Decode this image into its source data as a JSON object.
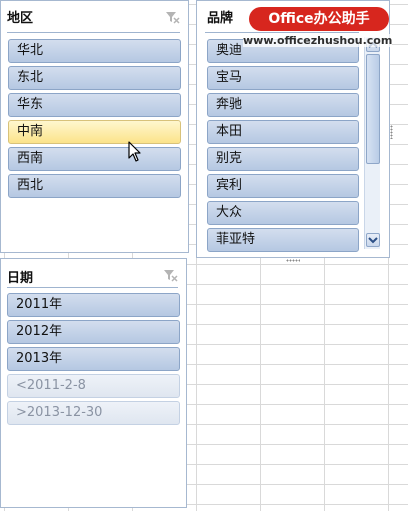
{
  "watermark": {
    "badge_text": "Office办公助手",
    "url": "www.officezhushou.com"
  },
  "slicers": {
    "region": {
      "title": "地区",
      "items": [
        "华北",
        "东北",
        "华东",
        "中南",
        "西南",
        "西北"
      ],
      "hovered_item": "中南"
    },
    "brand": {
      "title": "品牌",
      "items": [
        "奥迪",
        "宝马",
        "奔驰",
        "本田",
        "别克",
        "宾利",
        "大众",
        "菲亚特"
      ]
    },
    "date": {
      "title": "日期",
      "items": [
        "2011年",
        "2012年",
        "2013年"
      ],
      "nodata_items": [
        "<2011-2-8",
        ">2013-12-30"
      ]
    }
  },
  "colors": {
    "item_fill": "#b5c8e2",
    "item_hover": "#fbe38a",
    "brand_red": "#d7261e"
  },
  "icons": {
    "clear_filter": "clear-filter-icon",
    "scroll_up": "scroll-up-icon",
    "scroll_down": "scroll-down-icon",
    "cursor": "mouse-cursor-icon"
  }
}
